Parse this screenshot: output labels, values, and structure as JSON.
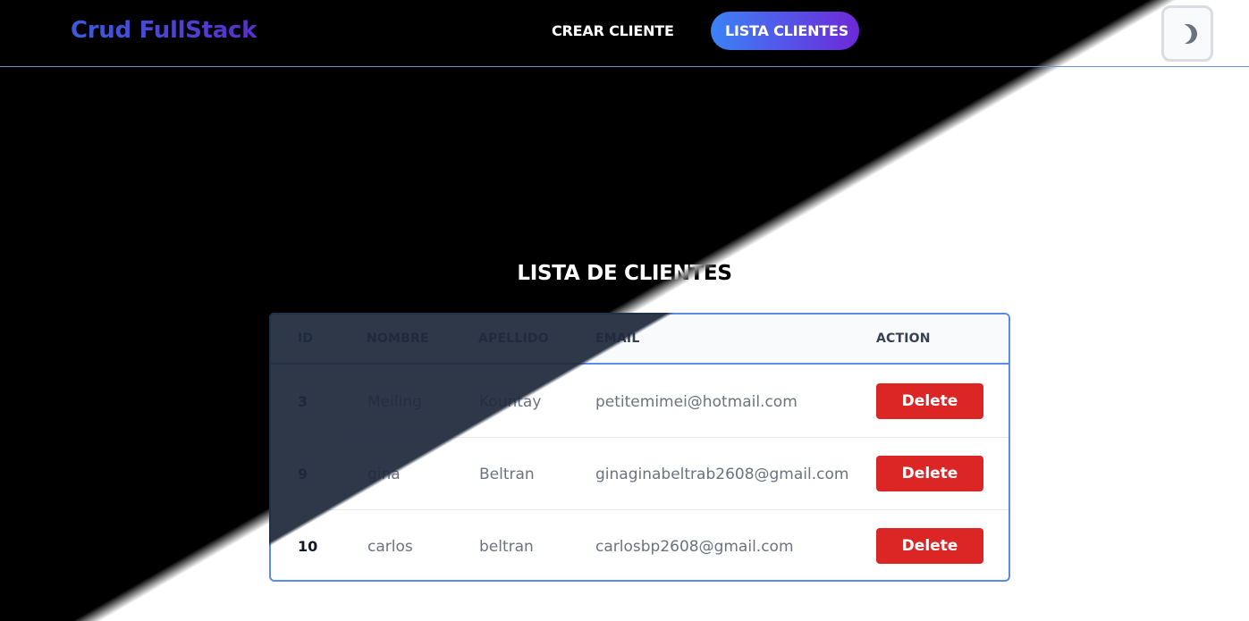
{
  "app": {
    "brand": "Crud FullStack"
  },
  "nav": {
    "crear_label": "CREAR CLIENTE",
    "lista_label": "LISTA CLIENTES"
  },
  "theme_toggle": {
    "icon": "moon-icon"
  },
  "page": {
    "title": "LISTA DE CLIENTES"
  },
  "table": {
    "headers": [
      "ID",
      "NOMBRE",
      "APELLIDO",
      "EMAIL",
      "ACTION"
    ],
    "rows": [
      {
        "id": "3",
        "nombre": "Meiling",
        "apellido": "Kountay",
        "email": "petitemimei@hotmail.com",
        "action": "Delete"
      },
      {
        "id": "9",
        "nombre": "gina",
        "apellido": "Beltran",
        "email": "ginaginabeltrab2608@gmail.com",
        "action": "Delete"
      },
      {
        "id": "10",
        "nombre": "carlos",
        "apellido": "beltran",
        "email": "carlosbp2608@gmail.com",
        "action": "Delete"
      }
    ]
  },
  "colors": {
    "accent_blue": "#3b82f6",
    "accent_purple": "#6d28d9",
    "delete_red": "#dc2626",
    "table_border": "#5b8be6"
  }
}
